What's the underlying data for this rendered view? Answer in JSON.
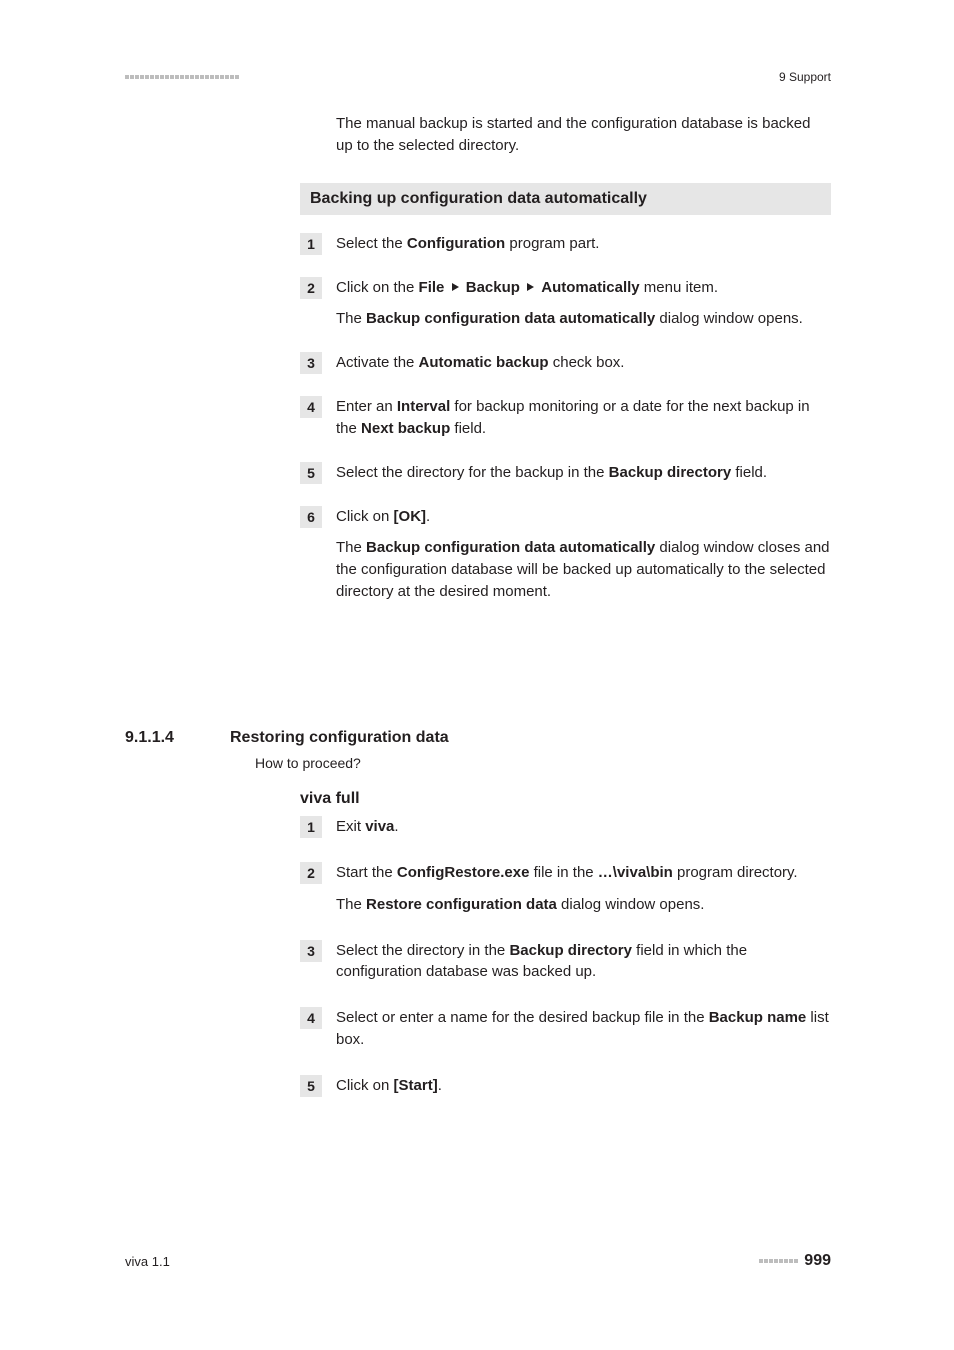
{
  "header": {
    "right": "9 Support"
  },
  "intro": "The manual backup is started and the configuration database is backed up to the selected directory.",
  "section_bar": "Backing up configuration data automatically",
  "steps": [
    {
      "n": "1",
      "p1a": "Select the ",
      "p1b": "Configuration",
      "p1c": " program part."
    },
    {
      "n": "2",
      "p1a": "Click on the ",
      "p1b": "File",
      "p1c": "Backup",
      "p1d": "Automatically",
      "p1e": " menu item.",
      "p2a": "The ",
      "p2b": "Backup configuration data automatically",
      "p2c": " dialog window opens."
    },
    {
      "n": "3",
      "p1a": "Activate the ",
      "p1b": "Automatic backup",
      "p1c": " check box."
    },
    {
      "n": "4",
      "p1a": "Enter an ",
      "p1b": "Interval",
      "p1c": " for backup monitoring or a date for the next backup in the ",
      "p1d": "Next backup",
      "p1e": " field."
    },
    {
      "n": "5",
      "p1a": "Select the directory for the backup in the ",
      "p1b": "Backup directory",
      "p1c": " field."
    },
    {
      "n": "6",
      "p1a": "Click on ",
      "p1b": "[OK]",
      "p1c": ".",
      "p2a": "The ",
      "p2b": "Backup configuration data automatically",
      "p2c": " dialog window closes and the configuration database will be backed up automatically to the selected directory at the desired moment."
    }
  ],
  "sec": {
    "num": "9.1.1.4",
    "title": "Restoring configuration data",
    "howto": "How to proceed?",
    "viva_full": "viva full"
  },
  "steps2": [
    {
      "n": "1",
      "p1a": "Exit ",
      "p1b": "viva",
      "p1c": "."
    },
    {
      "n": "2",
      "p1a": "Start the ",
      "p1b": "ConfigRestore.exe",
      "p1c": " file in the ",
      "p1d": "…\\viva\\bin",
      "p1e": " program directory.",
      "p2a": "The ",
      "p2b": "Restore configuration data",
      "p2c": " dialog window opens."
    },
    {
      "n": "3",
      "p1a": "Select the directory in the ",
      "p1b": "Backup directory",
      "p1c": " field in which the configuration database was backed up."
    },
    {
      "n": "4",
      "p1a": "Select or enter a name for the desired backup file in the ",
      "p1b": "Backup name",
      "p1c": " list box."
    },
    {
      "n": "5",
      "p1a": "Click on ",
      "p1b": "[Start]",
      "p1c": "."
    }
  ],
  "footer": {
    "left": "viva 1.1",
    "page": "999"
  }
}
